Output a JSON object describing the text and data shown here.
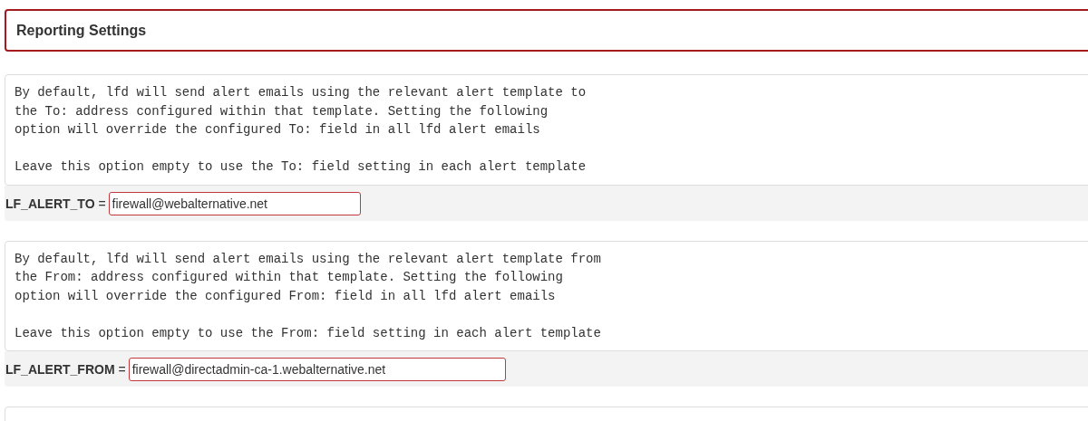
{
  "section": {
    "title": "Reporting Settings"
  },
  "settings": [
    {
      "paragraphs": [
        "By default, lfd will send alert emails using the relevant alert template to\nthe To: address configured within that template. Setting the following\noption will override the configured To: field in all lfd alert emails",
        "Leave this option empty to use the To: field setting in each alert template"
      ],
      "name": "LF_ALERT_TO",
      "separator": "=",
      "value": "firewall@webalternative.net"
    },
    {
      "paragraphs": [
        "By default, lfd will send alert emails using the relevant alert template from\nthe From: address configured within that template. Setting the following\noption will override the configured From: field in all lfd alert emails",
        "Leave this option empty to use the From: field setting in each alert template"
      ],
      "name": "LF_ALERT_FROM",
      "separator": "=",
      "value": "firewall@directadmin-ca-1.webalternative.net"
    }
  ]
}
